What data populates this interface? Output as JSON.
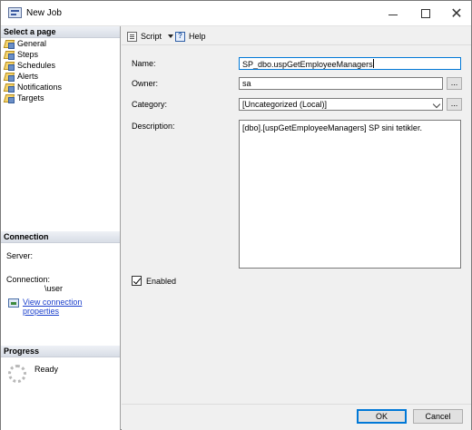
{
  "window": {
    "title": "New Job",
    "controls": {
      "minimize_icon": "minimize-icon",
      "maximize_icon": "maximize-icon",
      "close_icon": "close-icon"
    }
  },
  "left": {
    "select_page_header": "Select a page",
    "pages": [
      {
        "label": "General",
        "icon": "wrench-icon"
      },
      {
        "label": "Steps",
        "icon": "wrench-icon"
      },
      {
        "label": "Schedules",
        "icon": "wrench-icon"
      },
      {
        "label": "Alerts",
        "icon": "wrench-icon"
      },
      {
        "label": "Notifications",
        "icon": "wrench-icon"
      },
      {
        "label": "Targets",
        "icon": "wrench-icon"
      }
    ],
    "connection_header": "Connection",
    "server_label": "Server:",
    "connection_label": "Connection:",
    "connection_value": "\\user",
    "view_connection_link": "View connection properties",
    "progress_header": "Progress",
    "progress_status": "Ready"
  },
  "toolbar": {
    "script_label": "Script",
    "help_label": "Help"
  },
  "form": {
    "name_label": "Name:",
    "name_value": "SP_dbo.uspGetEmployeeManagers",
    "owner_label": "Owner:",
    "owner_value": "sa",
    "ellipsis": "...",
    "category_label": "Category:",
    "category_value": "[Uncategorized (Local)]",
    "description_label": "Description:",
    "description_value": "[dbo].[uspGetEmployeeManagers] SP sini tetikler.",
    "enabled_label": "Enabled"
  },
  "footer": {
    "ok_label": "OK",
    "cancel_label": "Cancel"
  },
  "colors": {
    "accent": "#0078d7",
    "link": "#1a3fcc",
    "window_bg": "#f0f0f0"
  }
}
